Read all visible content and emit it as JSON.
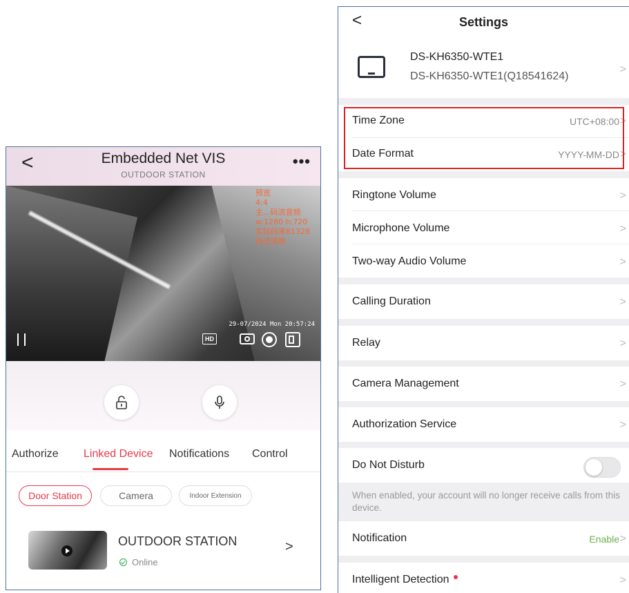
{
  "left": {
    "header": {
      "title": "Embedded Net VIS",
      "subtitle": "OUTDOOR STATION"
    },
    "video": {
      "overlay_lines": [
        "预览",
        "4:4",
        "主...码流音频",
        "w:1280 h:720",
        "实际码率81328",
        "码流清晰"
      ],
      "timestamp": "29-07/2024 Mon 20:57:24",
      "hd_label": "HD"
    },
    "tabs": [
      "Authorize",
      "Linked Device",
      "Notifications",
      "Control"
    ],
    "active_tab": "Linked Device",
    "chips": [
      "Door Station",
      "Camera",
      "Indoor Extension"
    ],
    "device": {
      "name": "OUTDOOR STATION",
      "status": "Online"
    }
  },
  "right": {
    "header": {
      "title": "Settings"
    },
    "device": {
      "model": "DS-KH6350-WTE1",
      "serial": "DS-KH6350-WTE1(Q18541624)"
    },
    "rows": {
      "time_zone": {
        "label": "Time Zone",
        "value": "UTC+08:00"
      },
      "date_format": {
        "label": "Date Format",
        "value": "YYYY-MM-DD"
      },
      "ringtone": {
        "label": "Ringtone Volume"
      },
      "microphone": {
        "label": "Microphone Volume"
      },
      "two_way": {
        "label": "Two-way Audio Volume"
      },
      "calling_duration": {
        "label": "Calling Duration"
      },
      "relay": {
        "label": "Relay"
      },
      "camera_mgmt": {
        "label": "Camera Management"
      },
      "auth_service": {
        "label": "Authorization Service"
      },
      "dnd": {
        "label": "Do Not Disturb",
        "enabled": false
      },
      "notification": {
        "label": "Notification",
        "value": "Enable"
      },
      "intelligent": {
        "label": "Intelligent Detection"
      }
    },
    "dnd_hint": "When enabled, your account will no longer receive calls from this device."
  },
  "colors": {
    "accent": "#e6394a",
    "highlight_border": "#e02020",
    "enable_green": "#6ab04c"
  }
}
